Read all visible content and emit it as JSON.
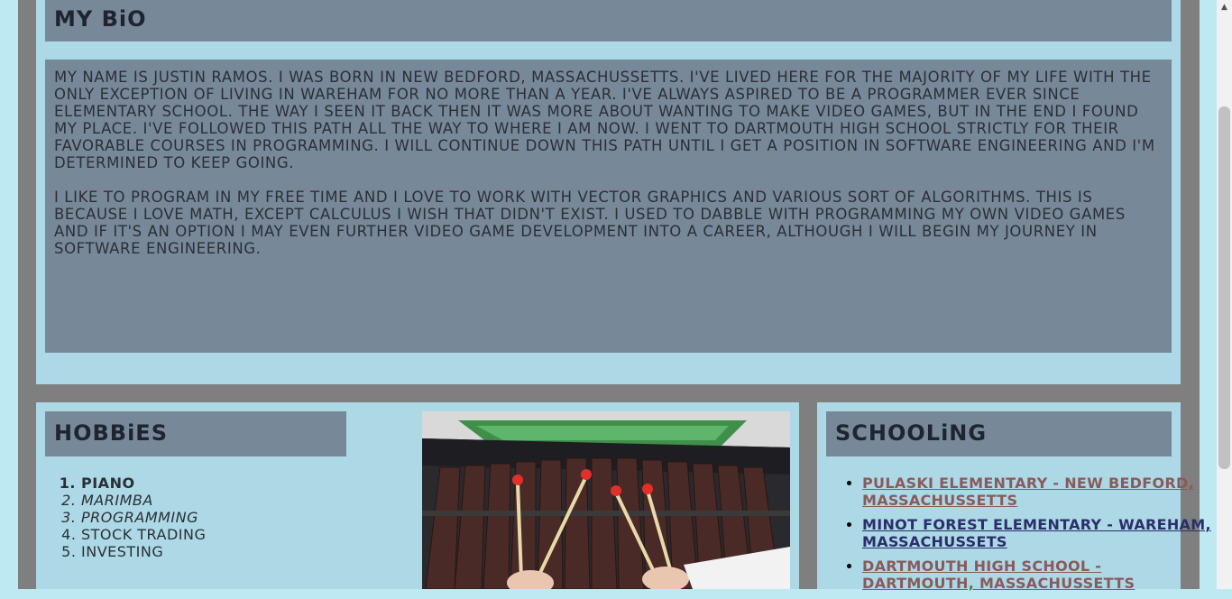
{
  "bio": {
    "title": "MY BiO",
    "paragraphs": [
      "My name is Justin Ramos. I was born in New Bedford, Massachussetts. I've lived here for the majority of my life with the only exception of living in Wareham for no more than a year. I've always aspired to be a programmer ever since elementary school. The way I seen it back then it was more about wanting to make video games, but in the end I found my place. I've followed this path all the way to where I am now. I went to Dartmouth High School strictly for their favorable courses in programming. I will continue down this path until I get a position in software engineering and I'm determined to keep going.",
      "I like to program in my free time and I love to work with vector graphics and various sort of algorithms. This is because I love math, except calculus I wish that didn't exist. I used to dabble with programming my own video games and if it's an option I may even further video game development into a career, although I will begin my journey in software engineering."
    ]
  },
  "hobbies": {
    "title": "HOBBiES",
    "items": [
      "PIANO",
      "MARIMBA",
      "PROGRAMMING",
      "STOCK TRADiNG",
      "iNVESTiNG"
    ]
  },
  "schooling": {
    "title": "SCHOOLiNG",
    "items": [
      {
        "label": "PULASKi ELEMENTARY - NEW BEDFORD, MASSACHUSSETTS",
        "color": "#8a5a5a"
      },
      {
        "label": "MiNOT FOREST ELEMENTARY - WAREHAM, MASSACHUSSETS",
        "color": "#2a2f6a"
      },
      {
        "label": "DARTMOUTH HiGH SCHOOL - DARTMOUTH, MASSACHUSSETTS",
        "color": "#8a5a5a"
      }
    ]
  },
  "colors": {
    "page": "#bfe9f2",
    "frame": "#7f7f7f",
    "panel": "#add8e6",
    "heading": "#778899"
  }
}
